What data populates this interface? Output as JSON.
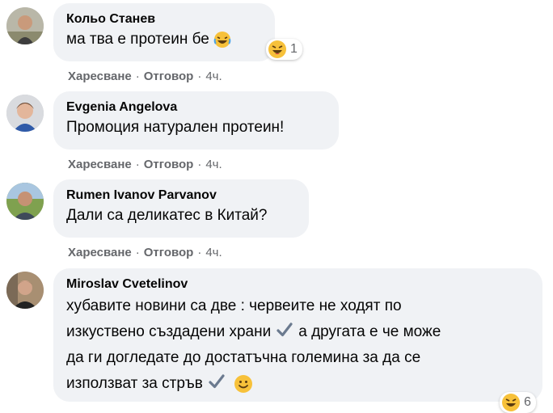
{
  "comments": [
    {
      "author": "Кольо Станев",
      "text": "ма тва е протеин бе",
      "reaction_count": "1",
      "like": "Харесване",
      "reply": "Отговор",
      "time": "4ч."
    },
    {
      "author": "Evgenia Angelova",
      "text": "Промоция натурален протеин!",
      "like": "Харесване",
      "reply": "Отговор",
      "time": "4ч."
    },
    {
      "author": "Rumen Ivanov Parvanov",
      "text": "Дали са деликатес в Китай?",
      "like": "Харесване",
      "reply": "Отговор",
      "time": "4ч."
    },
    {
      "author": "Miroslav Cvetelinov",
      "line1": "хубавите новини са две : червеите не ходят по",
      "line2a": "изкуствено създадени храни",
      "line2b": "а другата е че може",
      "line3": "да ги догледате до достатъчна големина за да се",
      "line4": "използват за стръв",
      "reaction_count": "6"
    }
  ],
  "icons": {
    "laugh": "laughing-emoji-icon",
    "check": "check-mark-icon",
    "smile": "slightly-smiling-emoji-icon"
  }
}
